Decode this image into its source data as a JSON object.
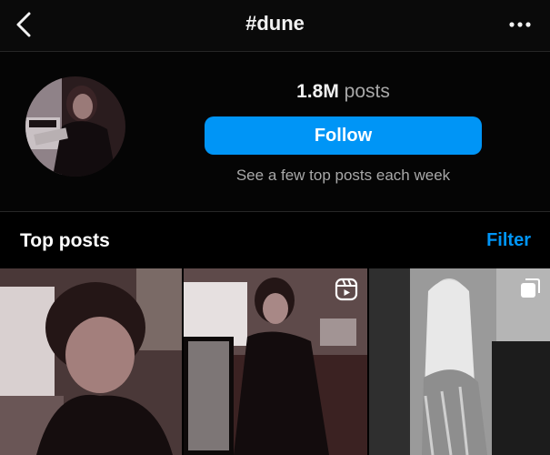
{
  "header": {
    "title": "#dune",
    "back_icon": "chevron-left-icon",
    "more_icon": "more-horizontal-icon"
  },
  "hashtag": {
    "post_count": "1.8M",
    "post_unit": "posts",
    "follow_label": "Follow",
    "subtitle": "See a few top posts each week"
  },
  "top_posts": {
    "title": "Top posts",
    "filter_label": "Filter",
    "posts": [
      {
        "type": "photo",
        "badge_icon": ""
      },
      {
        "type": "reel",
        "badge_icon": "reels-icon"
      },
      {
        "type": "carousel",
        "badge_icon": "carousel-icon"
      }
    ]
  },
  "colors": {
    "accent": "#0095f6",
    "background": "#000000",
    "secondary_text": "#a8a8a8"
  }
}
